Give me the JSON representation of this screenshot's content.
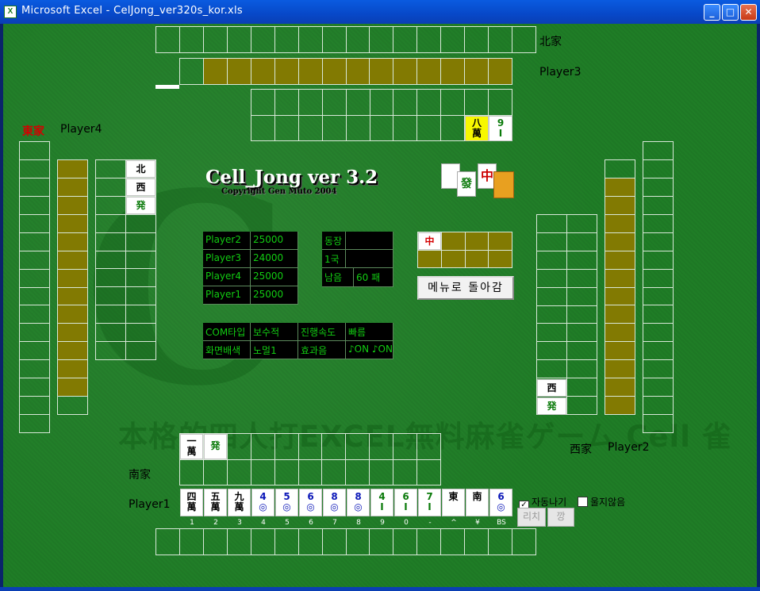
{
  "window": {
    "title": "Microsoft Excel - CelJong_ver320s_kor.xls",
    "app_icon": "X"
  },
  "seats": {
    "north": {
      "wind": "北家",
      "player": "Player3"
    },
    "east": {
      "wind": "東家",
      "player": "Player4"
    },
    "south": {
      "wind": "南家",
      "player": "Player1"
    },
    "west": {
      "wind": "西家",
      "player": "Player2"
    }
  },
  "logo": {
    "title": "Cell_Jong ver 3.2",
    "copyright": "Copyright Gen Muto 2004"
  },
  "scores": [
    {
      "name": "Player2",
      "score": "25000"
    },
    {
      "name": "Player3",
      "score": "24000"
    },
    {
      "name": "Player4",
      "score": "25000"
    },
    {
      "name": "Player1",
      "score": "25000"
    }
  ],
  "round": {
    "r1": "동장",
    "r2": "1국",
    "remaining_label": "남음",
    "remaining_value": "60 패"
  },
  "settings": [
    {
      "label": "COM타입",
      "value": "보수적",
      "label2": "진행속도",
      "value2": "빠름"
    },
    {
      "label": "화면배색",
      "value": "노멀1",
      "label2": "효과음",
      "value2": "♪ON ♪ON"
    }
  ],
  "menu_button": "메뉴로 돌아감",
  "dora_tile": "中",
  "north_discards": [
    {
      "top": "八",
      "bottom": "萬",
      "color": "yellow"
    },
    {
      "top": "9",
      "bottom": "I",
      "color": "green"
    }
  ],
  "east_discards": [
    "北",
    "西",
    "発"
  ],
  "west_discards": [
    "西",
    "発"
  ],
  "south_discards": [
    {
      "top": "一",
      "bottom": "萬"
    },
    {
      "top": "発",
      "bottom": ""
    }
  ],
  "hand": [
    {
      "top": "四",
      "bottom": "萬",
      "key": "1",
      "color": "black"
    },
    {
      "top": "五",
      "bottom": "萬",
      "key": "2",
      "color": "black"
    },
    {
      "top": "九",
      "bottom": "萬",
      "key": "3",
      "color": "black"
    },
    {
      "top": "4",
      "bottom": "◎",
      "key": "4",
      "color": "blue"
    },
    {
      "top": "5",
      "bottom": "◎",
      "key": "5",
      "color": "blue"
    },
    {
      "top": "6",
      "bottom": "◎",
      "key": "6",
      "color": "blue"
    },
    {
      "top": "8",
      "bottom": "◎",
      "key": "7",
      "color": "blue"
    },
    {
      "top": "8",
      "bottom": "◎",
      "key": "8",
      "color": "blue"
    },
    {
      "top": "4",
      "bottom": "I",
      "key": "9",
      "color": "green"
    },
    {
      "top": "6",
      "bottom": "I",
      "key": "0",
      "color": "green"
    },
    {
      "top": "7",
      "bottom": "I",
      "key": "-",
      "color": "green"
    },
    {
      "top": "東",
      "bottom": "",
      "key": "^",
      "color": "black"
    },
    {
      "top": "南",
      "bottom": "",
      "key": "¥",
      "color": "black"
    },
    {
      "top": "6",
      "bottom": "◎",
      "key": "BS",
      "color": "blue"
    }
  ],
  "options": {
    "auto_discard": "자동나기",
    "auto_discard_checked": true,
    "no_call": "울지않음",
    "no_call_checked": false
  },
  "buttons": {
    "riichi": "리치",
    "kong": "깡"
  },
  "watermark": "本格的四人打EXCEL無料麻雀ゲーム Cell 雀"
}
